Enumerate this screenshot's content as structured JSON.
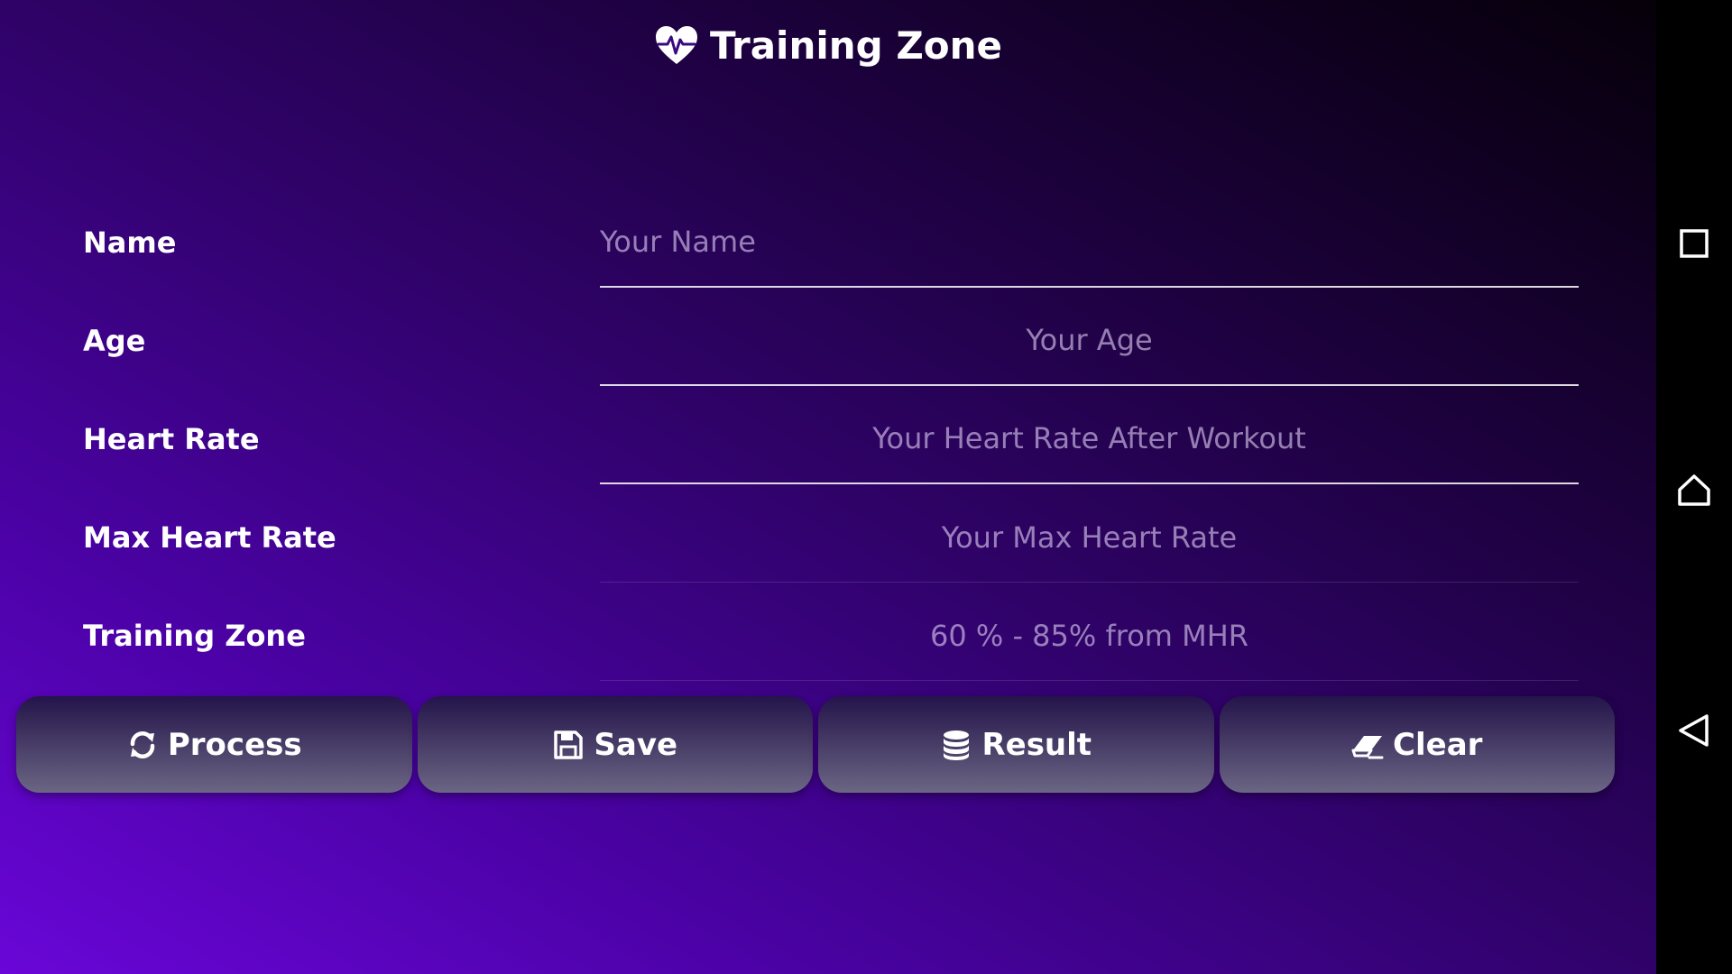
{
  "app": {
    "title": "Training Zone",
    "title_icon": "heart-pulse-icon"
  },
  "form": {
    "name": {
      "label": "Name",
      "placeholder": "Your Name",
      "value": ""
    },
    "age": {
      "label": "Age",
      "placeholder": "Your Age",
      "value": ""
    },
    "heart_rate": {
      "label": "Heart Rate",
      "placeholder": "Your Heart Rate After Workout",
      "value": ""
    },
    "max_heart_rate": {
      "label": "Max Heart Rate",
      "placeholder": "Your Max Heart Rate",
      "value": ""
    },
    "training_zone": {
      "label": "Training Zone",
      "value": "60 % - 85% from MHR"
    }
  },
  "buttons": {
    "process": {
      "label": "Process",
      "icon": "refresh-icon"
    },
    "save": {
      "label": "Save",
      "icon": "floppy-disk-icon"
    },
    "result": {
      "label": "Result",
      "icon": "database-icon"
    },
    "clear": {
      "label": "Clear",
      "icon": "eraser-icon"
    }
  },
  "navbar": {
    "recents_icon": "square-icon",
    "home_icon": "home-icon",
    "back_icon": "back-triangle-icon"
  },
  "colors": {
    "background_start": "#6a06d8",
    "background_end": "#060009",
    "text": "#ffffff",
    "placeholder": "#b8a6d4",
    "button_top": "#24144a",
    "button_bottom": "#6b6684",
    "navbar": "#000000"
  }
}
